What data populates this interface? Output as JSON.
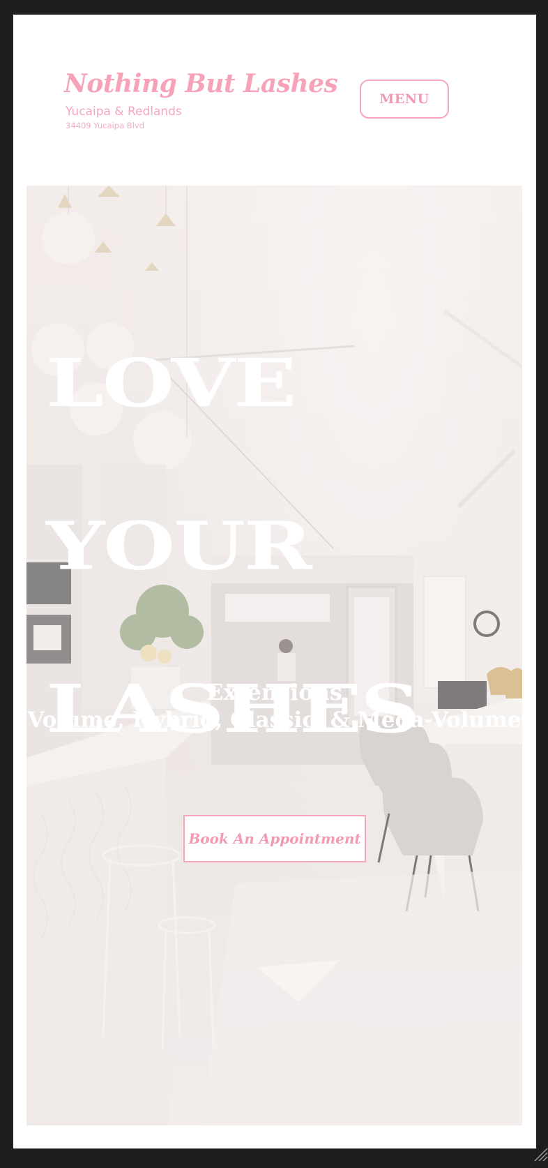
{
  "header": {
    "brand_title": "Nothing But Lashes",
    "brand_subtitle": "Yucaipa & Redlands",
    "brand_address": "34409 Yucaipa Blvd",
    "menu_label": "MENU"
  },
  "hero": {
    "headline_lines": [
      "LOVE",
      "YOUR",
      "LASHES"
    ],
    "services_title": "Extensions",
    "services_line": "Volume, Hybrid, Classic, & Mega-Volume",
    "cta_label": "Book An Appointment",
    "background_image": "salon-interior-photo"
  },
  "colors": {
    "accent_pink": "#f6a3b9",
    "page_bg": "#ffffff",
    "window_frame": "#1e1e20"
  }
}
